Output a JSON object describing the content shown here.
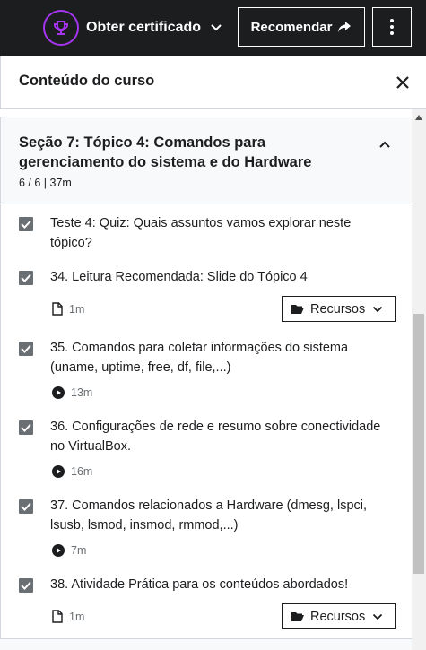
{
  "topbar": {
    "certificate_label": "Obter certificado",
    "recommend_label": "Recomendar"
  },
  "panel": {
    "title": "Conteúdo do curso"
  },
  "section": {
    "title": "Seção 7: Tópico 4: Comandos para gerenciamento do sistema e do Hardware",
    "meta": "6 / 6 | 37m"
  },
  "lessons": [
    {
      "title": "Teste 4: Quiz: Quais assuntos vamos explorar neste tópico?",
      "completed": true
    },
    {
      "title": "34. Leitura Recomendada: Slide do Tópico 4",
      "type": "file",
      "duration": "1m",
      "resources_label": "Recursos",
      "completed": true
    },
    {
      "title": "35. Comandos para coletar informações do sistema (uname, uptime, free, df, file,...)",
      "type": "video",
      "duration": "13m",
      "completed": true
    },
    {
      "title": "36. Configurações de rede e resumo sobre conectividade no VirtualBox.",
      "type": "video",
      "duration": "16m",
      "completed": true
    },
    {
      "title": "37. Comandos relacionados a Hardware (dmesg, lspci, lsusb, lsmod, insmod, rmmod,...)",
      "type": "video",
      "duration": "7m",
      "completed": true
    },
    {
      "title": "38. Atividade Prática para os conteúdos abordados!",
      "type": "file",
      "duration": "1m",
      "resources_label": "Recursos",
      "completed": true
    }
  ],
  "colors": {
    "topbar_bg": "#1c1d1f",
    "accent": "#a435f0",
    "checkbox": "#6a6f73",
    "section_bg": "#f7f9fa"
  }
}
